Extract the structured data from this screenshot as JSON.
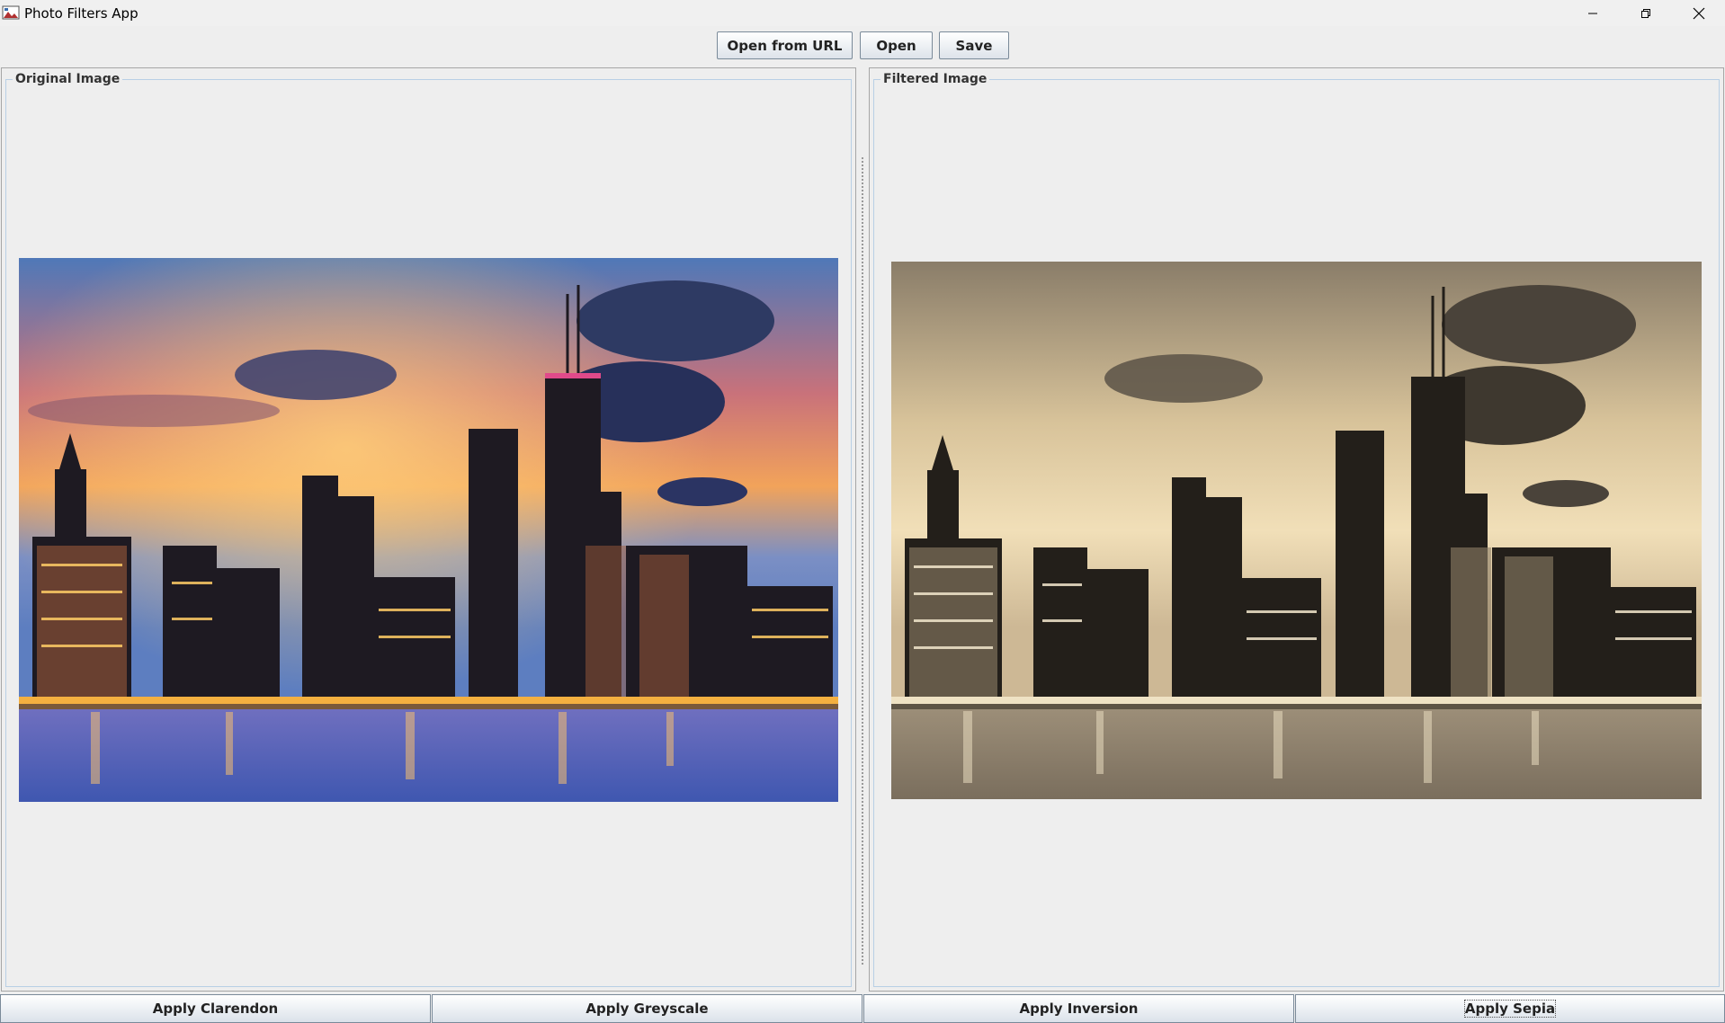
{
  "window": {
    "title": "Photo Filters App",
    "controls": [
      "minimize-icon",
      "restore-icon",
      "close-icon"
    ]
  },
  "toolbar": {
    "open_url_label": "Open from URL",
    "open_label": "Open",
    "save_label": "Save"
  },
  "panels": {
    "original_title": "Original Image",
    "filtered_title": "Filtered Image"
  },
  "filters": {
    "clarendon_label": "Apply Clarendon",
    "greyscale_label": "Apply Greyscale",
    "inversion_label": "Apply Inversion",
    "sepia_label": "Apply Sepia"
  },
  "active_filter": "Apply Sepia",
  "colors": {
    "window_bg": "#eeeeee",
    "border_title": "#b8cfe5",
    "sepia_tone": "#cdb58f"
  }
}
